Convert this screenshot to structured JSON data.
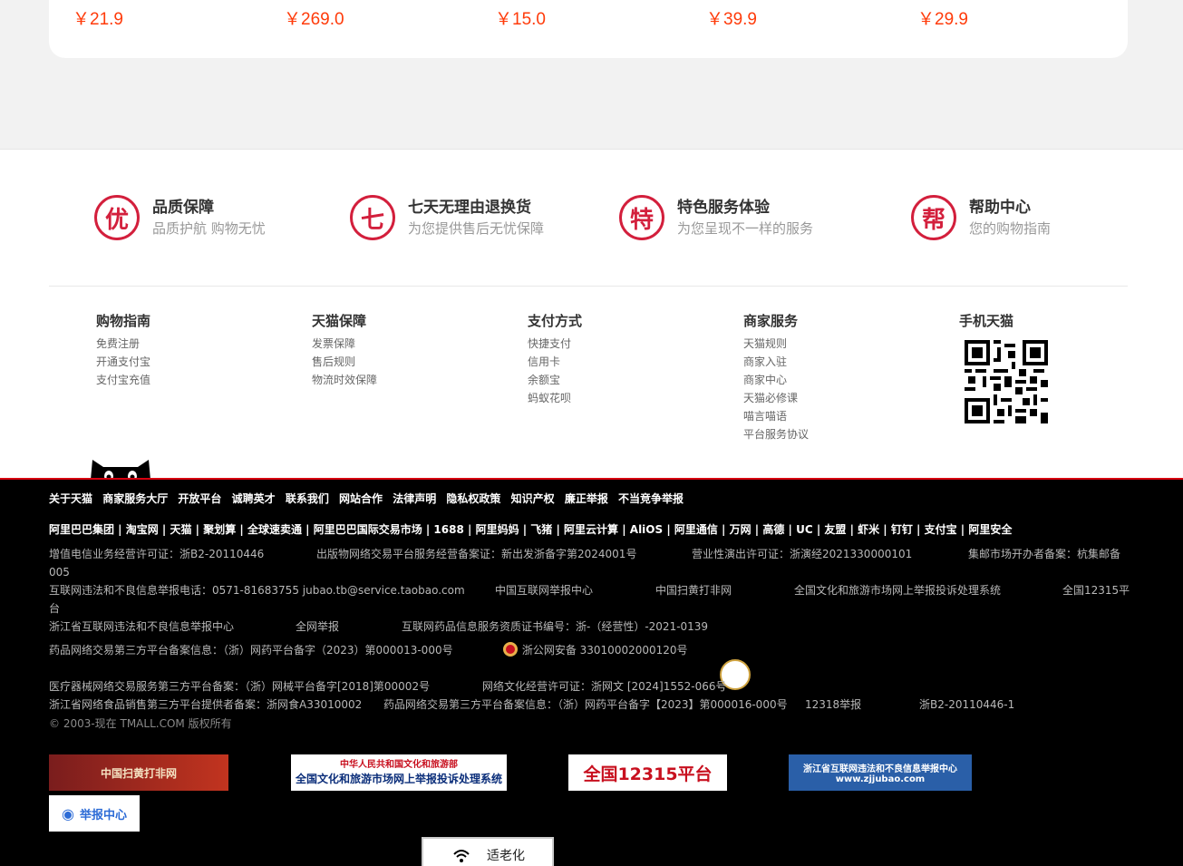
{
  "prices": [
    "￥21.9",
    "￥269.0",
    "￥15.0",
    "￥39.9",
    "￥29.9"
  ],
  "services": [
    {
      "icon": "优",
      "title": "品质保障",
      "sub": "品质护航 购物无忧"
    },
    {
      "icon": "七",
      "title": "七天无理由退换货",
      "sub": "为您提供售后无忧保障"
    },
    {
      "icon": "特",
      "title": "特色服务体验",
      "sub": "为您呈现不一样的服务"
    },
    {
      "icon": "帮",
      "title": "帮助中心",
      "sub": "您的购物指南"
    }
  ],
  "columns": [
    {
      "title": "购物指南",
      "links": [
        "免费注册",
        "开通支付宝",
        "支付宝充值"
      ]
    },
    {
      "title": "天猫保障",
      "links": [
        "发票保障",
        "售后规则",
        "物流时效保障"
      ]
    },
    {
      "title": "支付方式",
      "links": [
        "快捷支付",
        "信用卡",
        "余额宝",
        "蚂蚁花呗"
      ]
    },
    {
      "title": "商家服务",
      "links": [
        "天猫规则",
        "商家入驻",
        "商家中心",
        "天猫必修课",
        "喵言喵语",
        "平台服务协议"
      ]
    },
    {
      "title": "手机天猫",
      "links": []
    }
  ],
  "footer_links": [
    "关于天猫",
    "商家服务大厅",
    "开放平台",
    "诚聘英才",
    "联系我们",
    "网站合作",
    "法律声明",
    "隐私权政策",
    "知识产权",
    "廉正举报",
    "不当竞争举报"
  ],
  "group_links": "阿里巴巴集团 | 淘宝网 | 天猫 | 聚划算 | 全球速卖通 | 阿里巴巴国际交易市场 | 1688 | 阿里妈妈 | 飞猪 | 阿里云计算 | AliOS | 阿里通信 | 万网 | 高德 | UC | 友盟 | 虾米 | 钉钉 | 支付宝 | 阿里安全",
  "licenses": {
    "l1": "增值电信业务经营许可证：浙B2-20110446",
    "l2": "出版物网络交易平台服务经营备案证：新出发浙备字第2024001号",
    "l3": "营业性演出许可证：浙演经2021330000101",
    "l4": "集邮市场开办者备案：杭集邮备",
    "l4b": "005",
    "l5": "互联网违法和不良信息举报电话：0571-81683755 jubao.tb@service.taobao.com",
    "l6": "中国互联网举报中心",
    "l7": "中国扫黄打非网",
    "l8": "全国文化和旅游市场网上举报投诉处理系统",
    "l9": "全国12315平",
    "l9b": "台",
    "l10": "浙江省互联网违法和不良信息举报中心",
    "l11": "全网举报",
    "l12": "互联网药品信息服务资质证书编号：浙-（经营性）-2021-0139",
    "l13": "药品网络交易第三方平台备案信息：（浙）网药平台备字（2023）第000013-000号",
    "l14": "浙公网安备 33010002000120号",
    "l15": "医疗器械网络交易服务第三方平台备案：（浙）网械平台备字[2018]第00002号",
    "l16": "网络文化经营许可证：浙网文 [2024]1552-066号",
    "l17": "浙江省网络食品销售第三方平台提供者备案：浙网食A33010002",
    "l18": "药品网络交易第三方平台备案信息：（浙）网药平台备字【2023】第000016-000号",
    "l19": "12318举报",
    "l20": "浙B2-20110446-1"
  },
  "copyright": "© 2003-现在 TMALL.COM 版权所有",
  "badges": {
    "b1": "中国扫黄打非网",
    "b2_top": "中华人民共和国文化和旅游部",
    "b2_main": "全国文化和旅游市场网上举报投诉处理系统",
    "b3": "全国12315平台",
    "b4_top": "浙江省互联网违法和不良信息举报中心",
    "b4_url": "www.zjjubao.com",
    "b5": "举报中心"
  },
  "elder_mode": "适老化"
}
